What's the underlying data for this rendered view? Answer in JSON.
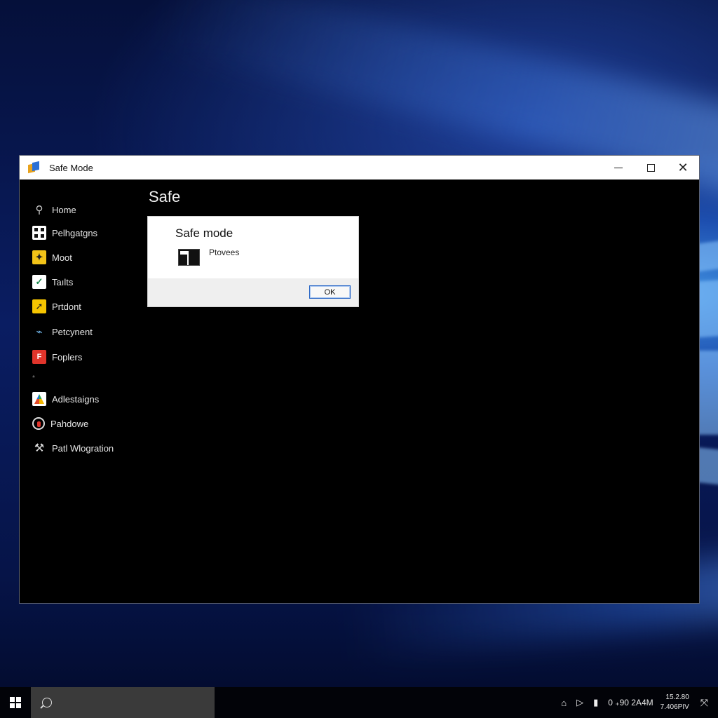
{
  "window": {
    "title": "Safe Mode",
    "controls": {
      "minimize": "minimize",
      "maximize": "maximize",
      "close": "✕"
    }
  },
  "sidebar": {
    "items": [
      {
        "label": "Home",
        "icon": "home-icon"
      },
      {
        "label": "Pelhgatgns",
        "icon": "grid-icon"
      },
      {
        "label": "Moot",
        "icon": "yellow-app-icon"
      },
      {
        "label": "Taılts",
        "icon": "check-app-icon"
      },
      {
        "label": "Prtdont",
        "icon": "yellow-arrow-icon"
      },
      {
        "label": "Petcynent",
        "icon": "device-icon"
      },
      {
        "label": "Foplers",
        "icon": "red-app-icon"
      },
      {
        "label": "Adlestaigns",
        "icon": "multicolor-icon"
      },
      {
        "label": "Pahdowe",
        "icon": "circle-icon"
      },
      {
        "label": "Patl Wlogration",
        "icon": "tools-icon"
      }
    ],
    "divider": "*"
  },
  "content": {
    "title": "Safe"
  },
  "dialog": {
    "title": "Safe mode",
    "message": "Ptovees",
    "ok_label": "OK"
  },
  "taskbar": {
    "tray_time": "0 ₊90 2A4M",
    "clock_line1": "15.2.80",
    "clock_line2": "7.406PIV"
  },
  "colors": {
    "window_bg": "#000000",
    "titlebar_bg": "#ffffff",
    "accent": "#1e5fc4",
    "taskbar_bg": "#020308"
  }
}
